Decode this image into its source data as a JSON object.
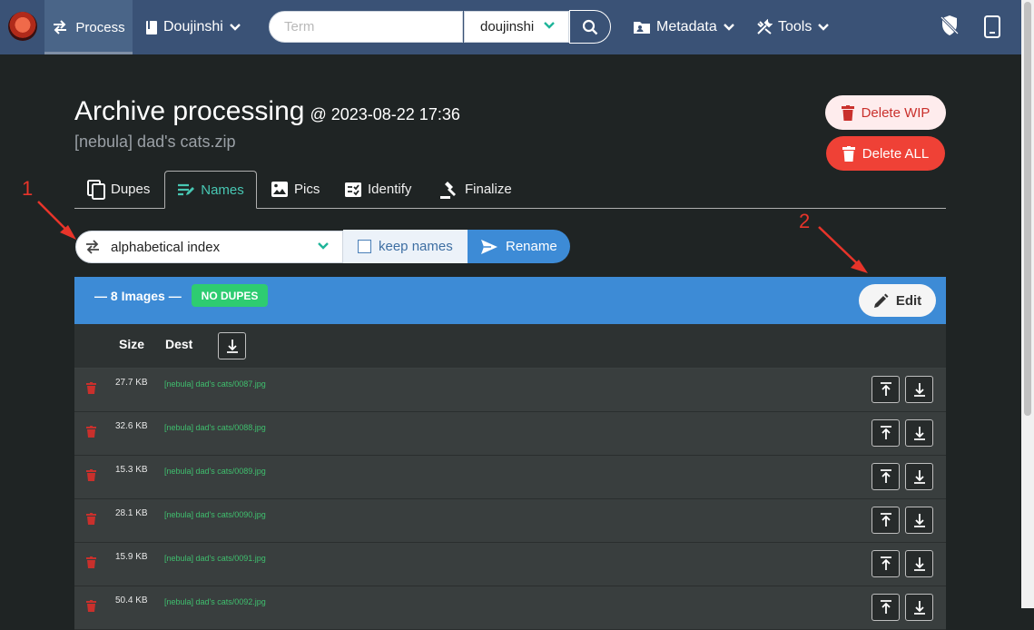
{
  "navbar": {
    "process_label": "Process",
    "category_label": "Doujinshi",
    "search_placeholder": "Term",
    "search_scope": "doujinshi",
    "metadata_label": "Metadata",
    "tools_label": "Tools"
  },
  "header": {
    "title": "Archive processing",
    "date": "@ 2023-08-22 17:36",
    "filename": "[nebula] dad's cats.zip",
    "delete_wip_label": "Delete WIP",
    "delete_all_label": "Delete ALL"
  },
  "tabs": [
    {
      "label": "Dupes"
    },
    {
      "label": "Names"
    },
    {
      "label": "Pics"
    },
    {
      "label": "Identify"
    },
    {
      "label": "Finalize"
    }
  ],
  "controls": {
    "rename_mode": "alphabetical index",
    "keep_names_label": "keep names",
    "rename_label": "Rename"
  },
  "images": {
    "count_label": "— 8 Images —",
    "badge": "NO DUPES",
    "edit_label": "Edit",
    "col_size": "Size",
    "col_dest": "Dest",
    "rows": [
      {
        "size": "27.7 KB",
        "dest": "[nebula] dad's cats/0087.jpg"
      },
      {
        "size": "32.6 KB",
        "dest": "[nebula] dad's cats/0088.jpg"
      },
      {
        "size": "15.3 KB",
        "dest": "[nebula] dad's cats/0089.jpg"
      },
      {
        "size": "28.1 KB",
        "dest": "[nebula] dad's cats/0090.jpg"
      },
      {
        "size": "15.9 KB",
        "dest": "[nebula] dad's cats/0091.jpg"
      },
      {
        "size": "50.4 KB",
        "dest": "[nebula] dad's cats/0092.jpg"
      }
    ]
  },
  "annotations": {
    "first": "1",
    "second": "2"
  },
  "colors": {
    "navbar": "#3a5276",
    "accent_blue": "#3d8bd6",
    "accent_teal": "#48c7b3",
    "danger": "#ef4136",
    "success": "#2ecc71",
    "annotation": "#e8342a"
  }
}
